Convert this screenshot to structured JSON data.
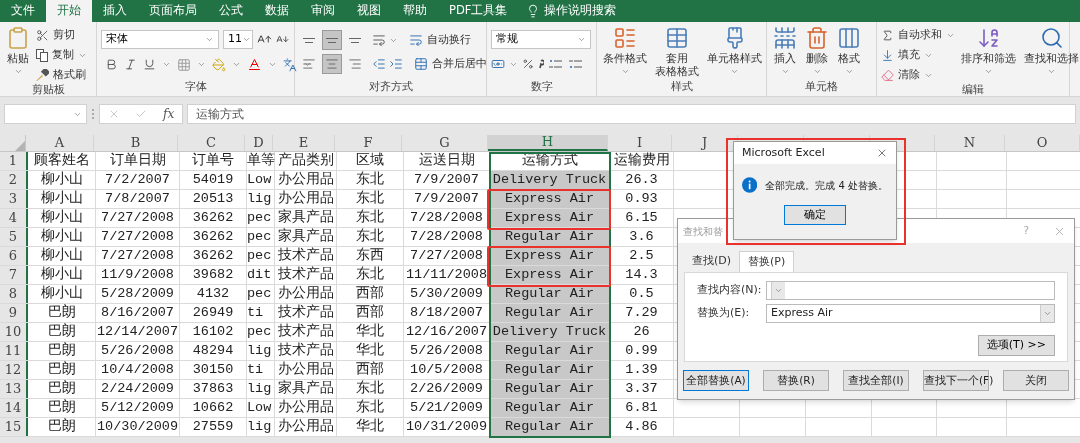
{
  "tabs": [
    {
      "label": "文件",
      "selected": false
    },
    {
      "label": "开始",
      "selected": true
    },
    {
      "label": "插入",
      "selected": false
    },
    {
      "label": "页面布局",
      "selected": false
    },
    {
      "label": "公式",
      "selected": false
    },
    {
      "label": "数据",
      "selected": false
    },
    {
      "label": "审阅",
      "selected": false
    },
    {
      "label": "视图",
      "selected": false
    },
    {
      "label": "帮助",
      "selected": false
    },
    {
      "label": "PDF工具集",
      "selected": false
    }
  ],
  "tell_me": "操作说明搜索",
  "ribbon": {
    "clipboard": {
      "label": "剪贴板",
      "paste": "粘贴",
      "cut": "剪切",
      "copy": "复制",
      "format_painter": "格式刷"
    },
    "font": {
      "label": "字体",
      "font_name": "宋体",
      "font_size": "11"
    },
    "alignment": {
      "label": "对齐方式",
      "wrap_text": "自动换行",
      "merge_center": "合并后居中",
      "vertical": [
        {
          "selected": false
        },
        {
          "selected": true
        },
        {
          "selected": false
        }
      ],
      "horizontal": [
        {
          "selected": false
        },
        {
          "selected": true
        },
        {
          "selected": false
        }
      ]
    },
    "number": {
      "label": "数字",
      "format": "常规"
    },
    "styles": {
      "label": "样式",
      "conditional": "条件格式",
      "table_format": [
        "套用",
        "表格格式"
      ],
      "cell_styles": "单元格样式"
    },
    "cells": {
      "label": "单元格",
      "insert": "插入",
      "delete": "删除",
      "format": "格式"
    },
    "editing": {
      "label": "编辑",
      "autosum": "自动求和",
      "fill": "填充",
      "clear": "清除",
      "sort_filter": "排序和筛选",
      "find_select": "查找和选择"
    }
  },
  "formula_bar": {
    "function_label": "fx",
    "formula": "运输方式"
  },
  "sheet": {
    "columns": [
      {
        "header": "A",
        "selected": false
      },
      {
        "header": "B",
        "selected": false
      },
      {
        "header": "C",
        "selected": false
      },
      {
        "header": "D",
        "selected": false
      },
      {
        "header": "E",
        "selected": false
      },
      {
        "header": "F",
        "selected": false
      },
      {
        "header": "G",
        "selected": false
      },
      {
        "header": "H",
        "selected": true
      },
      {
        "header": "I",
        "selected": false
      },
      {
        "header": "J",
        "selected": false
      },
      {
        "selected": false
      },
      {
        "selected": false
      },
      {
        "selected": false
      },
      {
        "header": "N",
        "selected": false
      },
      {
        "header": "O",
        "selected": false
      }
    ],
    "rows": [
      {
        "number": "1",
        "cells": [
          "顾客姓名",
          "订单日期",
          "订单号",
          "单等",
          "产品类别",
          "区域",
          "运送日期",
          "运输方式",
          "运输费用"
        ],
        "active": true,
        "boxed": false
      },
      {
        "number": "2",
        "cells": [
          "柳小山",
          "7/2/2007",
          "54019",
          "Low",
          "办公用品",
          "东北",
          "7/9/2007",
          "Delivery Truck",
          "26.3"
        ],
        "selected": true,
        "active": false,
        "boxed": false
      },
      {
        "number": "3",
        "cells": [
          "柳小山",
          "7/8/2007",
          "20513",
          "lig",
          "办公用品",
          "东北",
          "7/9/2007",
          "Express Air",
          "0.93"
        ],
        "selected": true,
        "active": false,
        "boxed": true
      },
      {
        "number": "4",
        "cells": [
          "柳小山",
          "7/27/2008",
          "36262",
          "pec",
          "家具产品",
          "东北",
          "7/28/2008",
          "Express Air",
          "6.15"
        ],
        "selected": true,
        "active": false,
        "boxed": true
      },
      {
        "number": "5",
        "cells": [
          "柳小山",
          "7/27/2008",
          "36262",
          "pec",
          "家具产品",
          "东北",
          "7/28/2008",
          "Regular Air",
          "3.6"
        ],
        "selected": true,
        "active": false,
        "boxed": false
      },
      {
        "number": "6",
        "cells": [
          "柳小山",
          "7/27/2008",
          "36262",
          "pec",
          "技术产品",
          "东西",
          "7/27/2008",
          "Express Air",
          "2.5"
        ],
        "selected": true,
        "active": false,
        "boxed": true
      },
      {
        "number": "7",
        "cells": [
          "柳小山",
          "11/9/2008",
          "39682",
          "dit",
          "技术产品",
          "东北",
          "11/11/2008",
          "Express Air",
          "14.3"
        ],
        "selected": true,
        "active": false,
        "boxed": true
      },
      {
        "number": "8",
        "cells": [
          "柳小山",
          "5/28/2009",
          "4132",
          "pec",
          "办公用品",
          "西部",
          "5/30/2009",
          "Regular Air",
          "0.5"
        ],
        "selected": true,
        "active": false,
        "boxed": false
      },
      {
        "number": "9",
        "cells": [
          "巴朗",
          "8/16/2007",
          "26949",
          "ti",
          "技术产品",
          "西部",
          "8/18/2007",
          "Regular Air",
          "7.29"
        ],
        "selected": true,
        "active": false,
        "boxed": false
      },
      {
        "number": "10",
        "cells": [
          "巴朗",
          "12/14/2007",
          "16102",
          "pec",
          "技术产品",
          "华北",
          "12/16/2007",
          "Delivery Truck",
          "26"
        ],
        "selected": true,
        "active": false,
        "boxed": false
      },
      {
        "number": "11",
        "cells": [
          "巴朗",
          "5/26/2008",
          "48294",
          "lig",
          "技术产品",
          "华北",
          "5/26/2008",
          "Regular Air",
          "0.99"
        ],
        "selected": true,
        "active": false,
        "boxed": false
      },
      {
        "number": "12",
        "cells": [
          "巴朗",
          "10/4/2008",
          "30150",
          "ti",
          "办公用品",
          "西部",
          "10/5/2008",
          "Regular Air",
          "1.39"
        ],
        "selected": true,
        "active": false,
        "boxed": false
      },
      {
        "number": "13",
        "cells": [
          "巴朗",
          "2/24/2009",
          "37863",
          "lig",
          "家具产品",
          "东北",
          "2/26/2009",
          "Regular Air",
          "3.37"
        ],
        "selected": true,
        "active": false,
        "boxed": false
      },
      {
        "number": "14",
        "cells": [
          "巴朗",
          "5/12/2009",
          "10662",
          "Low",
          "办公用品",
          "东北",
          "5/21/2009",
          "Regular Air",
          "6.81"
        ],
        "selected": true,
        "active": false,
        "boxed": false
      },
      {
        "number": "15",
        "cells": [
          "巴朗",
          "10/30/2009",
          "27559",
          "lig",
          "办公用品",
          "华北",
          "10/31/2009",
          "Regular Air",
          "4.86"
        ],
        "selected": true,
        "active": false,
        "boxed": false
      }
    ]
  },
  "find_replace": {
    "title": "查找和替",
    "help": "?",
    "tabs": [
      {
        "label": "查找(D)",
        "selected": false
      },
      {
        "label": "替换(P)",
        "selected": true
      }
    ],
    "fields": [
      {
        "label": "查找内容(N):"
      },
      {
        "label": "替换为(E):",
        "value": "Express Air"
      }
    ],
    "options": "选项(T) >>",
    "buttons": [
      {
        "label": "全部替换(A)",
        "focused": true
      },
      {
        "label": "替换(R)",
        "focused": false
      },
      {
        "label": "查找全部(I)",
        "focused": false
      },
      {
        "label": "查找下一个(F)",
        "focused": false
      },
      {
        "label": "关闭",
        "focused": false
      }
    ]
  },
  "message_box": {
    "title": "Microsoft Excel",
    "message": "全部完成。完成 4 处替换。",
    "button": "确定",
    "boxed": true
  }
}
